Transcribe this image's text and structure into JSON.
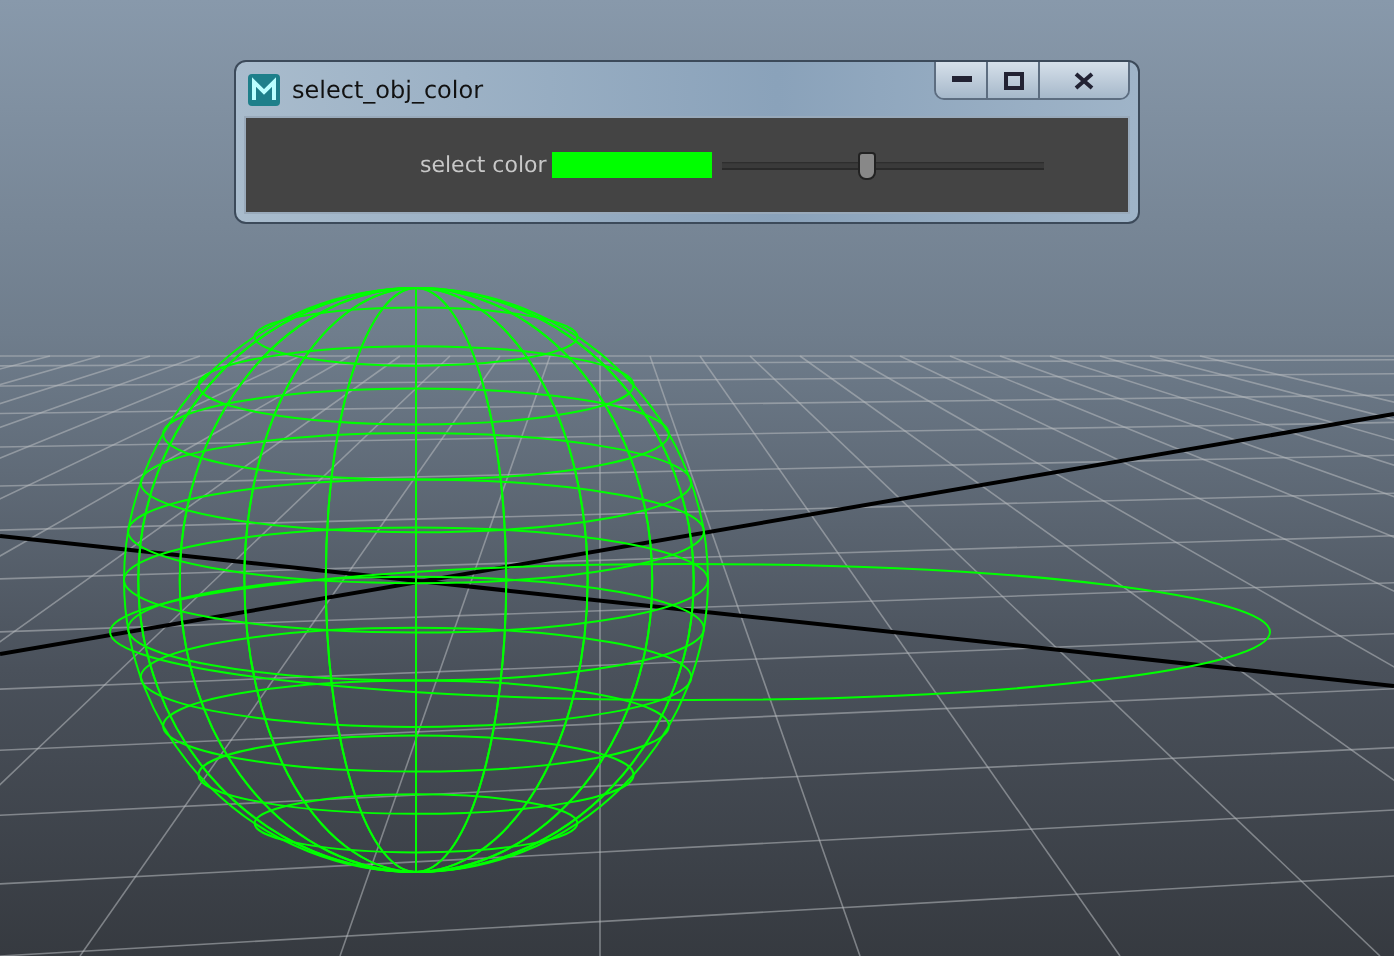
{
  "window": {
    "title": "select_obj_color"
  },
  "color_slider": {
    "label": "select color",
    "color": "#00ff00",
    "level": 0.45
  }
}
